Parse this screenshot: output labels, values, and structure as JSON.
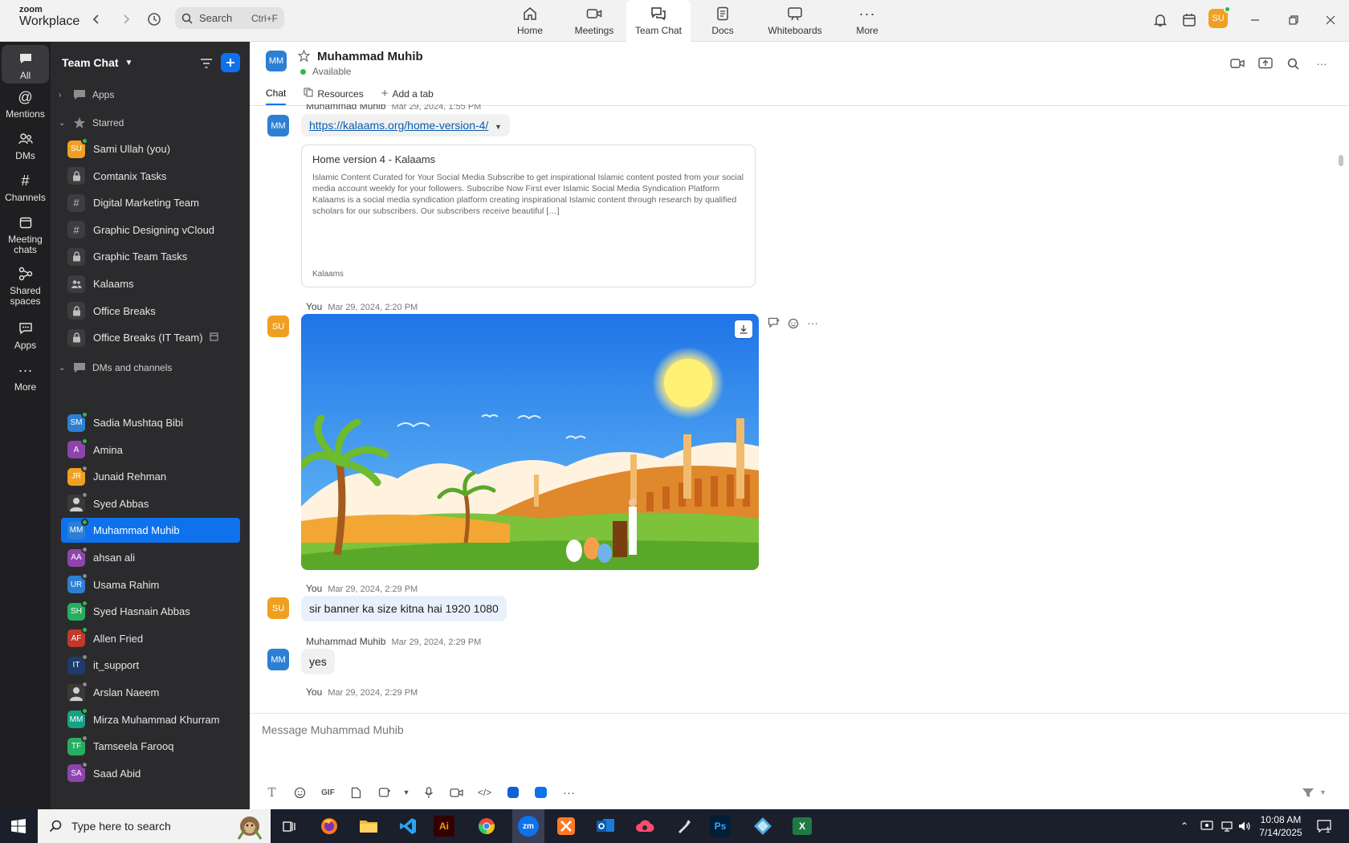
{
  "app": {
    "brand_top": "zoom",
    "brand_bottom": "Workplace"
  },
  "search": {
    "placeholder": "Search",
    "shortcut": "Ctrl+F"
  },
  "nav_tabs": [
    {
      "label": "Home",
      "icon": "home-icon"
    },
    {
      "label": "Meetings",
      "icon": "video-icon"
    },
    {
      "label": "Team Chat",
      "icon": "chat-icon",
      "active": true
    },
    {
      "label": "Docs",
      "icon": "doc-icon"
    },
    {
      "label": "Whiteboards",
      "icon": "whiteboard-icon"
    },
    {
      "label": "More",
      "icon": "more-dots-icon"
    }
  ],
  "top_avatar": "SU",
  "rail": [
    {
      "label": "All",
      "icon": "chat-bubble-icon",
      "active": true
    },
    {
      "label": "Mentions",
      "icon": "at-icon"
    },
    {
      "label": "DMs",
      "icon": "people-icon"
    },
    {
      "label": "Channels",
      "icon": "hash-icon"
    },
    {
      "label": "Meeting chats",
      "icon": "calendar-icon"
    },
    {
      "label": "Shared spaces",
      "icon": "shared-icon"
    },
    {
      "label": "Apps",
      "icon": "apps-icon"
    },
    {
      "label": "More",
      "icon": "more-dots-icon"
    }
  ],
  "sidebar": {
    "title": "Team Chat",
    "sections": {
      "apps": "Apps",
      "starred": "Starred",
      "dms": "DMs and channels"
    },
    "starred": [
      {
        "label": "Sami Ullah (you)",
        "kind": "avatar",
        "initials": "SU",
        "color": "#f0a020",
        "presence": "on"
      },
      {
        "label": "Comtanix Tasks",
        "kind": "lock"
      },
      {
        "label": "Digital Marketing Team",
        "kind": "hash"
      },
      {
        "label": "Graphic Designing vCloud",
        "kind": "hash"
      },
      {
        "label": "Graphic Team Tasks",
        "kind": "lock"
      },
      {
        "label": "Kalaams",
        "kind": "group"
      },
      {
        "label": "Office Breaks",
        "kind": "lock"
      },
      {
        "label": "Office Breaks (IT Team)",
        "kind": "lock",
        "extra": true
      }
    ],
    "dms": [
      {
        "label": "Sadia Mushtaq Bibi",
        "initials": "SM",
        "color": "#2d7fd4",
        "presence": "on"
      },
      {
        "label": "Amina",
        "initials": "A",
        "color": "#8e44ad",
        "presence": "on"
      },
      {
        "label": "Junaid Rehman",
        "initials": "JR",
        "color": "#f0a020",
        "presence": "off"
      },
      {
        "label": "Syed Abbas",
        "initials": "",
        "color": "#444444",
        "presence": "off",
        "photo": true
      },
      {
        "label": "Muhammad Muhib",
        "initials": "MM",
        "color": "#2d7fd4",
        "presence": "on",
        "active": true
      },
      {
        "label": "ahsan ali",
        "initials": "AA",
        "color": "#8e44ad",
        "presence": "off"
      },
      {
        "label": "Usama Rahim",
        "initials": "UR",
        "color": "#2d7fd4",
        "presence": "off"
      },
      {
        "label": "Syed Hasnain Abbas",
        "initials": "SH",
        "color": "#27ae60",
        "presence": "on"
      },
      {
        "label": "Allen Fried",
        "initials": "AF",
        "color": "#c0392b",
        "presence": "on"
      },
      {
        "label": "it_support",
        "initials": "IT",
        "color": "#1f3a6d",
        "presence": "off"
      },
      {
        "label": "Arslan Naeem",
        "initials": "",
        "color": "#555555",
        "presence": "off",
        "photo": true
      },
      {
        "label": "Mirza Muhammad Khurram",
        "initials": "MM",
        "color": "#16a085",
        "presence": "on"
      },
      {
        "label": "Tamseela Farooq",
        "initials": "TF",
        "color": "#27ae60",
        "presence": "off"
      },
      {
        "label": "Saad Abid",
        "initials": "SA",
        "color": "#8e44ad",
        "presence": "off"
      }
    ]
  },
  "chat": {
    "avatar": "MM",
    "name": "Muhammad Muhib",
    "status": "Available",
    "tabs": {
      "chat": "Chat",
      "resources": "Resources",
      "add": "Add a tab"
    },
    "messages": {
      "m1_meta_name": "Muhammad Muhib",
      "m1_meta_time": "Mar 29, 2024, 1:55 PM",
      "m1_link": "https://kalaams.org/home-version-4/",
      "preview_title": "Home version 4 - Kalaams",
      "preview_desc": "Islamic Content Curated for Your Social Media  Subscribe to get inspirational Islamic content posted from your social media account weekly for your followers. Subscribe  Now First ever Islamic Social Media Syndication Platform Kalaams is a social media syndication platform creating inspirational Islamic content through research by qualified scholars for our subscribers. Our subscribers receive beautiful […]",
      "preview_site": "Kalaams",
      "m2_meta_name": "You",
      "m2_meta_time": "Mar 29, 2024, 2:20 PM",
      "m3_meta_name": "You",
      "m3_meta_time": "Mar 29, 2024, 2:29 PM",
      "m3_text": "sir banner ka size kitna hai 1920 1080",
      "m4_meta_name": "Muhammad Muhib",
      "m4_meta_time": "Mar 29, 2024, 2:29 PM",
      "m4_text": "yes",
      "m5_meta_name": "You",
      "m5_meta_time": "Mar 29, 2024, 2:29 PM",
      "me_avatar": "SU",
      "them_avatar": "MM"
    },
    "composer_placeholder": "Message Muhammad Muhib",
    "toolbar_gif": "GIF"
  },
  "taskbar": {
    "search_placeholder": "Type here to search",
    "apps": [
      "task-view",
      "firefox",
      "file-explorer",
      "vscode",
      "illustrator",
      "chrome",
      "zoom",
      "xampp",
      "outlook",
      "creative-cloud",
      "pen-tool",
      "photoshop",
      "app-diamond",
      "excel"
    ],
    "labels": {
      "ai": "Ai",
      "zoom": "zm",
      "ps": "Ps",
      "excel": "X"
    },
    "time": "10:08 AM",
    "date": "7/14/2025",
    "notif_count": "1"
  },
  "colors": {
    "accent": "#0e72ed",
    "sidebar_bg": "#2b2b2d",
    "rail_bg": "#1f1f21"
  }
}
